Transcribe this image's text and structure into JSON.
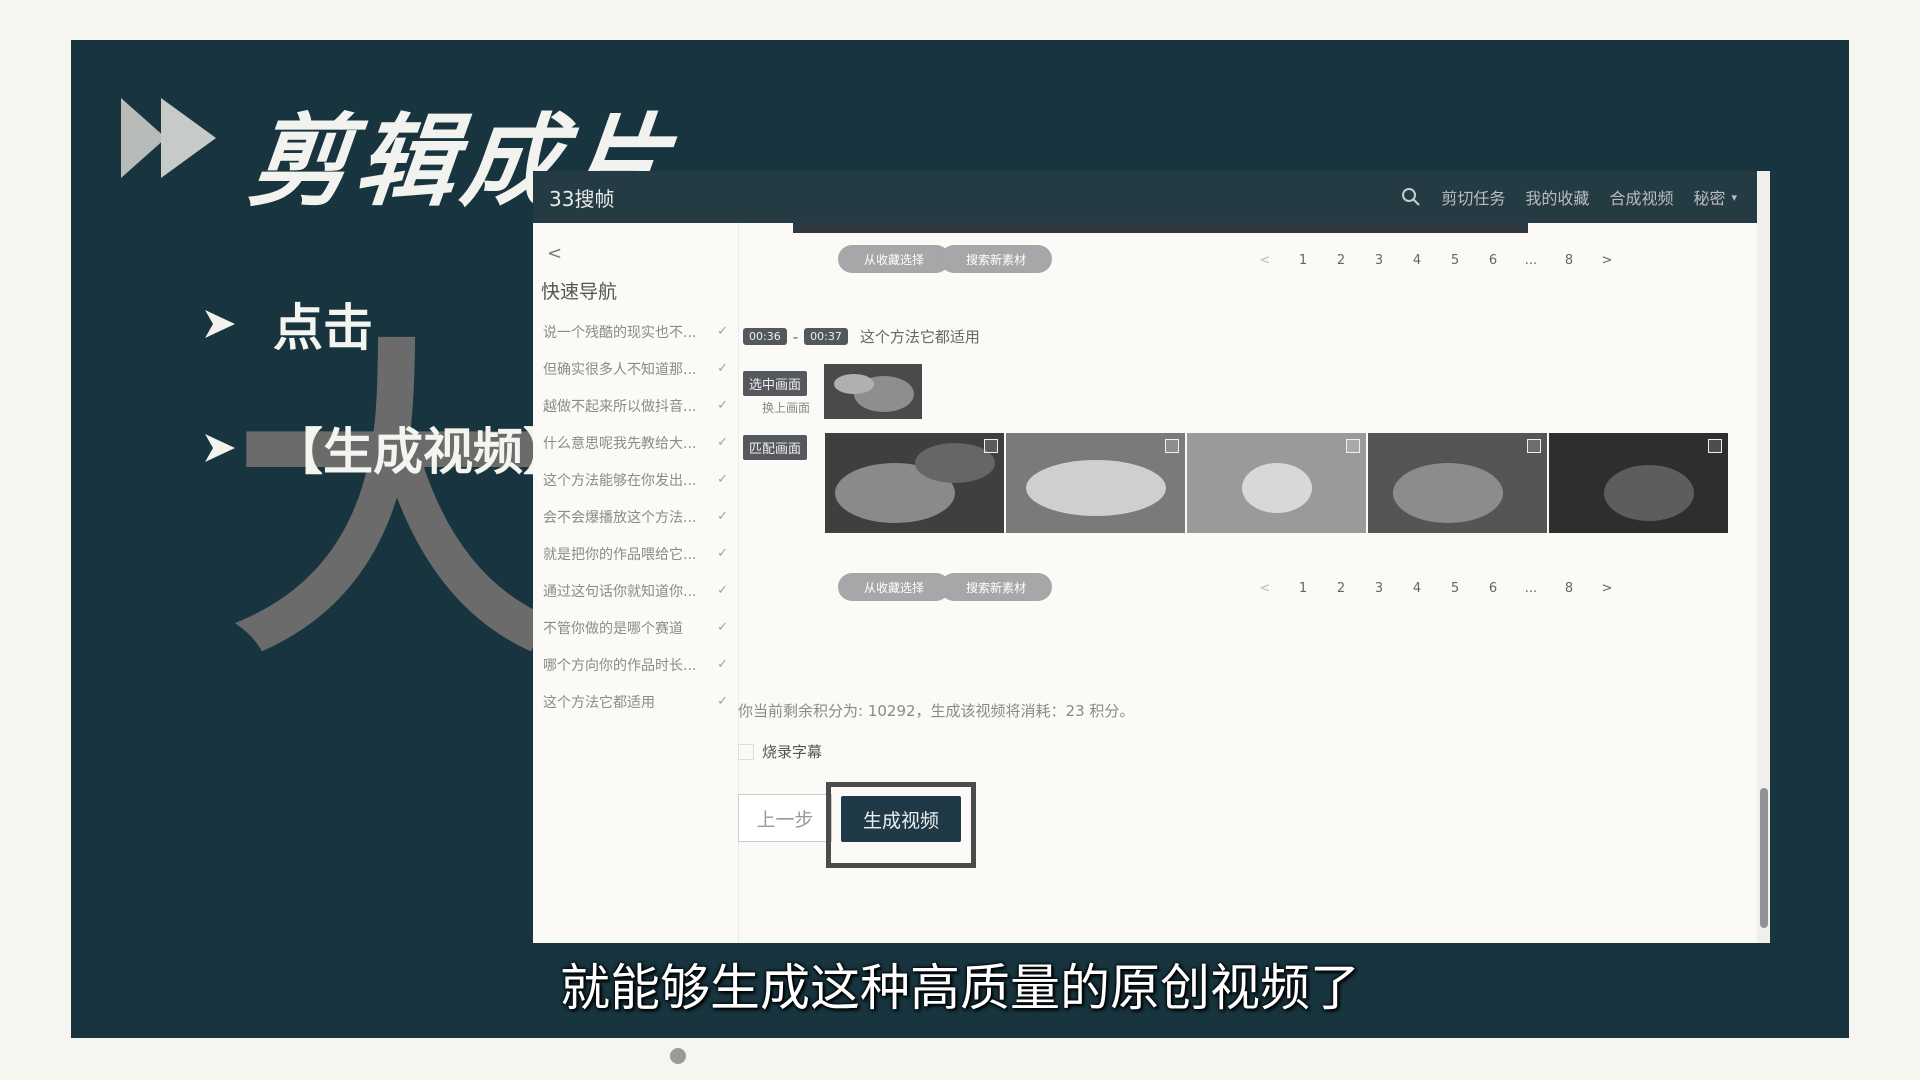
{
  "slide": {
    "headline": "剪辑成片",
    "big_char": "大",
    "bullets": [
      "点击",
      "【生成视频】"
    ]
  },
  "app": {
    "brand": "33搜帧",
    "topnav": [
      "剪切任务",
      "我的收藏",
      "合成视频",
      "秘密"
    ],
    "sidebar": {
      "back": "<",
      "title": "快速导航",
      "items": [
        "说一个残酷的现实也不...",
        "但确实很多人不知道那...",
        "越做不起来所以做抖音...",
        "什么意思呢我先教给大...",
        "这个方法能够在你发出...",
        "会不会爆播放这个方法...",
        "就是把你的作品喂给它...",
        "通过这句话你就知道你...",
        "不管你做的是哪个赛道",
        "哪个方向你的作品时长...",
        "这个方法它都适用"
      ]
    },
    "toolbar": {
      "from_favorites": "从收藏选择",
      "search_material": "搜索新素材"
    },
    "pager": [
      "<",
      "1",
      "2",
      "3",
      "4",
      "5",
      "6",
      "...",
      "8",
      ">"
    ],
    "segment": {
      "start": "00:36",
      "end": "00:37",
      "dash": "-",
      "text": "这个方法它都适用"
    },
    "selected_label": "选中画面",
    "selected_sub": "换上画面",
    "match_label": "匹配画面",
    "credits_text": "你当前剩余积分为: 10292，生成该视频将消耗：23 积分。",
    "burn_subtitles": "烧录字幕",
    "prev_button": "上一步",
    "generate_button": "生成视频"
  },
  "caption": "就能够生成这种高质量的原创视频了",
  "colors": {
    "slide_bg": "#17343f",
    "page_bg": "#f7f5ef",
    "primary_button": "#1f3a46",
    "big_char": "#6b6b6b"
  }
}
